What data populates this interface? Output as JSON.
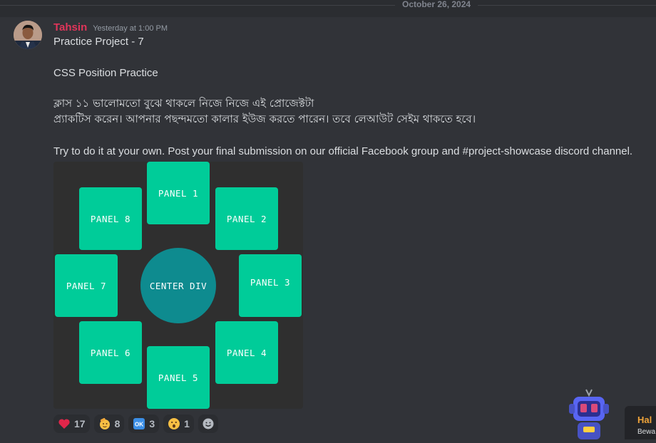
{
  "divider": {
    "date": "October 26, 2024"
  },
  "message": {
    "author": "Tahsin",
    "timestamp": "Yesterday at 1:00 PM",
    "lines": {
      "title": "Practice Project - 7",
      "subtitle": "CSS Position Practice",
      "bangla_1": "ক্লাস ১১ ভালোমতো বুঝে থাকলে নিজে নিজে এই প্রোজেক্টটা",
      "bangla_2": "প্র্যাকটিস করেন। আপনার পছন্দমতো কালার ইউজ করতে পারেন। তবে লেআউট সেইম থাকতে হবে।",
      "english": "Try to do it at your own. Post your final submission on our official Facebook group and #project-showcase discord channel."
    },
    "attachment": {
      "panels": [
        "PANEL 1",
        "PANEL 2",
        "PANEL 3",
        "PANEL 4",
        "PANEL 5",
        "PANEL 6",
        "PANEL 7",
        "PANEL 8"
      ],
      "center": "CENTER DIV",
      "colors": {
        "panel": "#00cc99",
        "center": "#0e8b8f",
        "background": "#2f2f2f"
      }
    },
    "reactions": [
      {
        "emoji": "heart-icon",
        "count": "17"
      },
      {
        "emoji": "saluting-face-icon",
        "count": "8"
      },
      {
        "emoji": "ok-button-icon",
        "label": "OK",
        "count": "3"
      },
      {
        "emoji": "surprised-face-icon",
        "count": "1"
      },
      {
        "emoji": "add-reaction-icon"
      }
    ]
  },
  "promo": {
    "title": "Hal",
    "subtitle": "Bewa"
  },
  "colors": {
    "author": "#e0355a",
    "background": "#313338"
  }
}
